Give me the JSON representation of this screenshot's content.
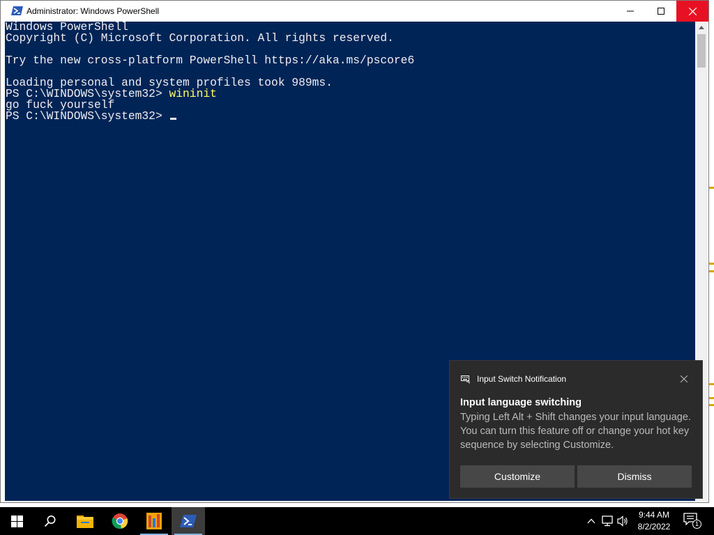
{
  "window": {
    "title": "Administrator: Windows PowerShell"
  },
  "console": {
    "background": "#012456",
    "text_color": "#eeedf0",
    "command_color": "#ffff66",
    "lines": {
      "l1": "Windows PowerShell",
      "l2": "Copyright (C) Microsoft Corporation. All rights reserved.",
      "l3": "",
      "l4": "Try the new cross-platform PowerShell https://aka.ms/pscore6",
      "l5": "",
      "l6": "Loading personal and system profiles took 989ms.",
      "l7_prompt": "PS C:\\WINDOWS\\system32> ",
      "l7_command": "wininit",
      "l8": "go fuck yourself",
      "l9_prompt": "PS C:\\WINDOWS\\system32> "
    }
  },
  "toast": {
    "app_name": "Input Switch Notification",
    "app_icon": "keyboard-icon",
    "title": "Input language switching",
    "body": "Typing Left Alt + Shift changes your input language. You can turn this feature off or change your hot key sequence by selecting Customize.",
    "customize_label": "Customize",
    "dismiss_label": "Dismiss"
  },
  "taskbar": {
    "items": [
      "windows-start-icon",
      "search-icon",
      "file-explorer-icon",
      "chrome-icon",
      "app-icon",
      "powershell-icon"
    ],
    "clock_time": "9:44 AM",
    "clock_date": "8/2/2022",
    "notification_count": "1"
  }
}
